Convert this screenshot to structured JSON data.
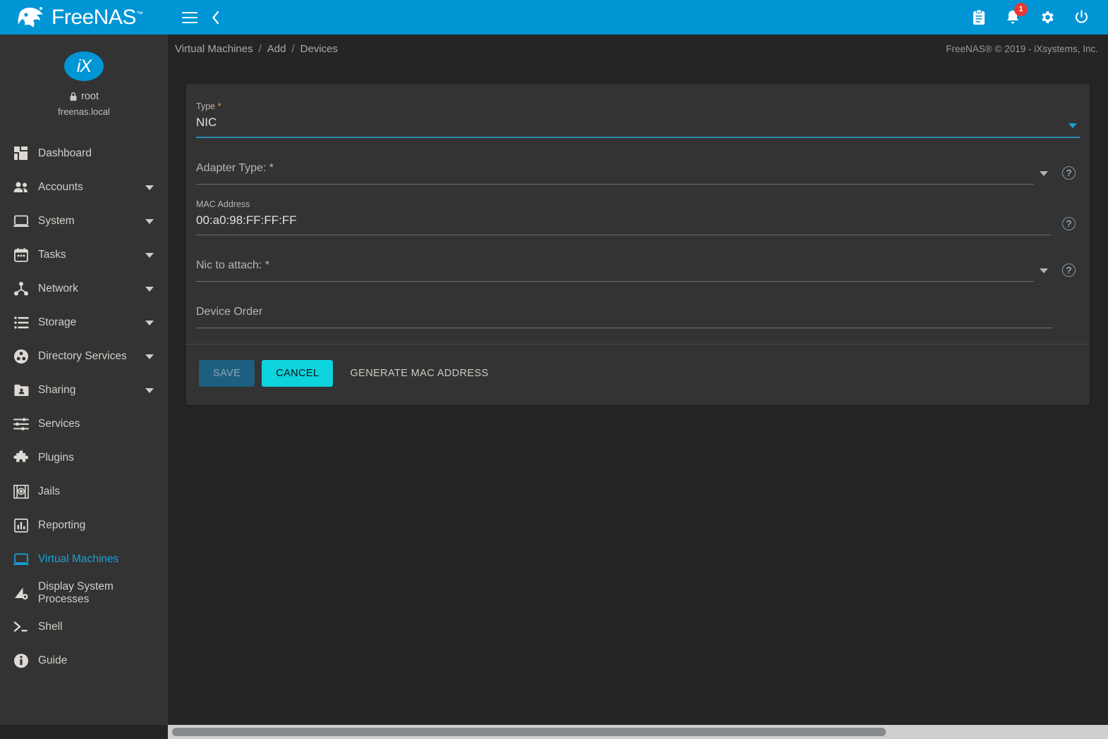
{
  "brand": {
    "name": "FreeNAS",
    "tm": "™",
    "logo_icon": "freenas-fish-logo"
  },
  "topbar": {
    "menu_icon": "hamburger-menu-icon",
    "back_icon": "chevron-left-icon",
    "clipboard_icon": "clipboard-icon",
    "notifications_icon": "bell-icon",
    "notifications_count": "1",
    "settings_icon": "gear-icon",
    "power_icon": "power-icon",
    "accent_color": "#0095d5"
  },
  "sidebar": {
    "avatar_text": "iX",
    "lock_icon": "lock-icon",
    "username": "root",
    "hostname": "freenas.local",
    "items": [
      {
        "label": "Dashboard",
        "icon": "dashboard-icon",
        "expandable": false,
        "active": false
      },
      {
        "label": "Accounts",
        "icon": "accounts-icon",
        "expandable": true,
        "active": false
      },
      {
        "label": "System",
        "icon": "system-icon",
        "expandable": true,
        "active": false
      },
      {
        "label": "Tasks",
        "icon": "tasks-icon",
        "expandable": true,
        "active": false
      },
      {
        "label": "Network",
        "icon": "network-icon",
        "expandable": true,
        "active": false
      },
      {
        "label": "Storage",
        "icon": "storage-icon",
        "expandable": true,
        "active": false
      },
      {
        "label": "Directory Services",
        "icon": "directory-services-icon",
        "expandable": true,
        "active": false
      },
      {
        "label": "Sharing",
        "icon": "sharing-icon",
        "expandable": true,
        "active": false
      },
      {
        "label": "Services",
        "icon": "services-icon",
        "expandable": false,
        "active": false
      },
      {
        "label": "Plugins",
        "icon": "plugins-icon",
        "expandable": false,
        "active": false
      },
      {
        "label": "Jails",
        "icon": "jails-icon",
        "expandable": false,
        "active": false
      },
      {
        "label": "Reporting",
        "icon": "reporting-icon",
        "expandable": false,
        "active": false
      },
      {
        "label": "Virtual Machines",
        "icon": "virtual-machines-icon",
        "expandable": false,
        "active": true
      },
      {
        "label": "Display System Processes",
        "icon": "display-system-processes-icon",
        "expandable": false,
        "active": false
      },
      {
        "label": "Shell",
        "icon": "shell-icon",
        "expandable": false,
        "active": false
      },
      {
        "label": "Guide",
        "icon": "guide-icon",
        "expandable": false,
        "active": false
      }
    ],
    "active_color": "#18a0d8"
  },
  "breadcrumb": {
    "items": [
      "Virtual Machines",
      "Add",
      "Devices"
    ],
    "separator": "/"
  },
  "footer": {
    "copyright": "FreeNAS® © 2019 - iXsystems, Inc."
  },
  "form": {
    "type_field": {
      "label": "Type",
      "required_mark": "*",
      "value": "NIC",
      "dropdown_icon": "chevron-down-icon",
      "focused": true
    },
    "adapter_type": {
      "placeholder": "Adapter Type: *",
      "value": "",
      "dropdown_icon": "chevron-down-icon",
      "help_icon": "help-circle-icon"
    },
    "mac_address": {
      "label": "MAC Address",
      "value": "00:a0:98:FF:FF:FF",
      "help_icon": "help-circle-icon"
    },
    "nic_to_attach": {
      "placeholder": "Nic to attach: *",
      "value": "",
      "dropdown_icon": "chevron-down-icon",
      "help_icon": "help-circle-icon"
    },
    "device_order": {
      "placeholder": "Device Order",
      "value": ""
    },
    "buttons": {
      "save": "SAVE",
      "cancel": "CANCEL",
      "generate_mac": "GENERATE MAC ADDRESS"
    }
  }
}
